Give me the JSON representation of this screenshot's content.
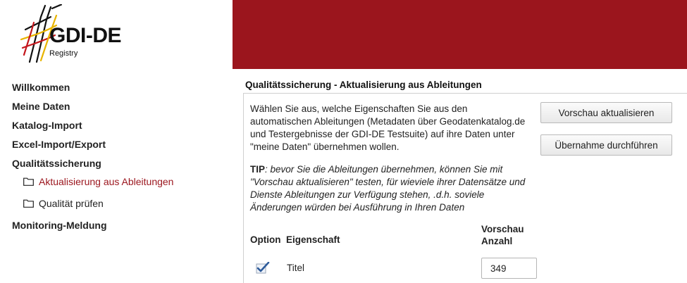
{
  "brand": {
    "title": "GDI-DE",
    "subtitle": "Registry",
    "accent": "#9b151d"
  },
  "sidebar": {
    "items": [
      {
        "label": "Willkommen"
      },
      {
        "label": "Meine Daten"
      },
      {
        "label": "Katalog-Import"
      },
      {
        "label": "Excel-Import/Export"
      },
      {
        "label": "Qualitätssicherung"
      }
    ],
    "sub_items": [
      {
        "label": "Aktualisierung aus Ableitungen",
        "icon": "folder-icon",
        "active": true
      },
      {
        "label": "Qualität prüfen",
        "icon": "folder-icon",
        "active": false
      }
    ],
    "last_item": {
      "label": "Monitoring-Meldung"
    }
  },
  "main": {
    "title": "Qualitätssicherung - Aktualisierung aus Ableitungen",
    "intro": "Wählen Sie aus, welche Eigenschaften Sie aus den automatischen Ableitungen (Metadaten über Geodatenkatalog.de und Testergebnisse der GDI-DE Testsuite) auf ihre Daten unter \"meine Daten\" übernehmen wollen.",
    "tip_label": "TIP",
    "tip_text": ": bevor Sie die Ableitungen übernehmen, können Sie mit \"Vorschau aktualisieren\" testen, für wieviele ihrer Datensätze und Dienste Ableitungen zur Verfügung stehen, .d.h. soviele Änderungen würden bei Ausführung in Ihren Daten",
    "buttons": {
      "preview": "Vorschau aktualisieren",
      "apply": "Übernahme durchführen"
    },
    "table": {
      "headers": {
        "option": "Option",
        "property": "Eigenschaft",
        "preview_count": "Vorschau Anzahl"
      },
      "rows": [
        {
          "checked": true,
          "property": "Titel",
          "count": "349"
        }
      ]
    }
  }
}
